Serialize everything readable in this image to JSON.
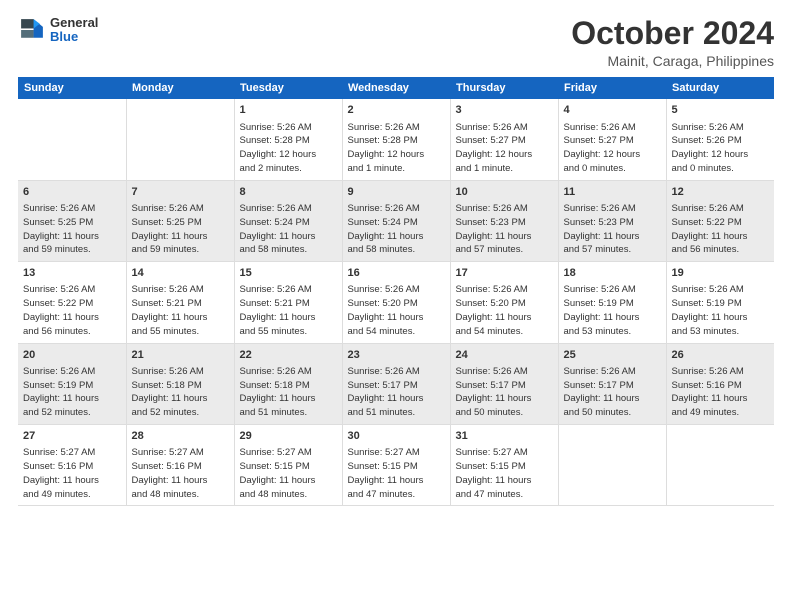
{
  "header": {
    "logo": {
      "general": "General",
      "blue": "Blue"
    },
    "title": "October 2024",
    "location": "Mainit, Caraga, Philippines"
  },
  "calendar": {
    "weekdays": [
      "Sunday",
      "Monday",
      "Tuesday",
      "Wednesday",
      "Thursday",
      "Friday",
      "Saturday"
    ],
    "weeks": [
      [
        {
          "day": "",
          "info": ""
        },
        {
          "day": "",
          "info": ""
        },
        {
          "day": "1",
          "info": "Sunrise: 5:26 AM\nSunset: 5:28 PM\nDaylight: 12 hours\nand 2 minutes."
        },
        {
          "day": "2",
          "info": "Sunrise: 5:26 AM\nSunset: 5:28 PM\nDaylight: 12 hours\nand 1 minute."
        },
        {
          "day": "3",
          "info": "Sunrise: 5:26 AM\nSunset: 5:27 PM\nDaylight: 12 hours\nand 1 minute."
        },
        {
          "day": "4",
          "info": "Sunrise: 5:26 AM\nSunset: 5:27 PM\nDaylight: 12 hours\nand 0 minutes."
        },
        {
          "day": "5",
          "info": "Sunrise: 5:26 AM\nSunset: 5:26 PM\nDaylight: 12 hours\nand 0 minutes."
        }
      ],
      [
        {
          "day": "6",
          "info": "Sunrise: 5:26 AM\nSunset: 5:25 PM\nDaylight: 11 hours\nand 59 minutes."
        },
        {
          "day": "7",
          "info": "Sunrise: 5:26 AM\nSunset: 5:25 PM\nDaylight: 11 hours\nand 59 minutes."
        },
        {
          "day": "8",
          "info": "Sunrise: 5:26 AM\nSunset: 5:24 PM\nDaylight: 11 hours\nand 58 minutes."
        },
        {
          "day": "9",
          "info": "Sunrise: 5:26 AM\nSunset: 5:24 PM\nDaylight: 11 hours\nand 58 minutes."
        },
        {
          "day": "10",
          "info": "Sunrise: 5:26 AM\nSunset: 5:23 PM\nDaylight: 11 hours\nand 57 minutes."
        },
        {
          "day": "11",
          "info": "Sunrise: 5:26 AM\nSunset: 5:23 PM\nDaylight: 11 hours\nand 57 minutes."
        },
        {
          "day": "12",
          "info": "Sunrise: 5:26 AM\nSunset: 5:22 PM\nDaylight: 11 hours\nand 56 minutes."
        }
      ],
      [
        {
          "day": "13",
          "info": "Sunrise: 5:26 AM\nSunset: 5:22 PM\nDaylight: 11 hours\nand 56 minutes."
        },
        {
          "day": "14",
          "info": "Sunrise: 5:26 AM\nSunset: 5:21 PM\nDaylight: 11 hours\nand 55 minutes."
        },
        {
          "day": "15",
          "info": "Sunrise: 5:26 AM\nSunset: 5:21 PM\nDaylight: 11 hours\nand 55 minutes."
        },
        {
          "day": "16",
          "info": "Sunrise: 5:26 AM\nSunset: 5:20 PM\nDaylight: 11 hours\nand 54 minutes."
        },
        {
          "day": "17",
          "info": "Sunrise: 5:26 AM\nSunset: 5:20 PM\nDaylight: 11 hours\nand 54 minutes."
        },
        {
          "day": "18",
          "info": "Sunrise: 5:26 AM\nSunset: 5:19 PM\nDaylight: 11 hours\nand 53 minutes."
        },
        {
          "day": "19",
          "info": "Sunrise: 5:26 AM\nSunset: 5:19 PM\nDaylight: 11 hours\nand 53 minutes."
        }
      ],
      [
        {
          "day": "20",
          "info": "Sunrise: 5:26 AM\nSunset: 5:19 PM\nDaylight: 11 hours\nand 52 minutes."
        },
        {
          "day": "21",
          "info": "Sunrise: 5:26 AM\nSunset: 5:18 PM\nDaylight: 11 hours\nand 52 minutes."
        },
        {
          "day": "22",
          "info": "Sunrise: 5:26 AM\nSunset: 5:18 PM\nDaylight: 11 hours\nand 51 minutes."
        },
        {
          "day": "23",
          "info": "Sunrise: 5:26 AM\nSunset: 5:17 PM\nDaylight: 11 hours\nand 51 minutes."
        },
        {
          "day": "24",
          "info": "Sunrise: 5:26 AM\nSunset: 5:17 PM\nDaylight: 11 hours\nand 50 minutes."
        },
        {
          "day": "25",
          "info": "Sunrise: 5:26 AM\nSunset: 5:17 PM\nDaylight: 11 hours\nand 50 minutes."
        },
        {
          "day": "26",
          "info": "Sunrise: 5:26 AM\nSunset: 5:16 PM\nDaylight: 11 hours\nand 49 minutes."
        }
      ],
      [
        {
          "day": "27",
          "info": "Sunrise: 5:27 AM\nSunset: 5:16 PM\nDaylight: 11 hours\nand 49 minutes."
        },
        {
          "day": "28",
          "info": "Sunrise: 5:27 AM\nSunset: 5:16 PM\nDaylight: 11 hours\nand 48 minutes."
        },
        {
          "day": "29",
          "info": "Sunrise: 5:27 AM\nSunset: 5:15 PM\nDaylight: 11 hours\nand 48 minutes."
        },
        {
          "day": "30",
          "info": "Sunrise: 5:27 AM\nSunset: 5:15 PM\nDaylight: 11 hours\nand 47 minutes."
        },
        {
          "day": "31",
          "info": "Sunrise: 5:27 AM\nSunset: 5:15 PM\nDaylight: 11 hours\nand 47 minutes."
        },
        {
          "day": "",
          "info": ""
        },
        {
          "day": "",
          "info": ""
        }
      ]
    ]
  }
}
